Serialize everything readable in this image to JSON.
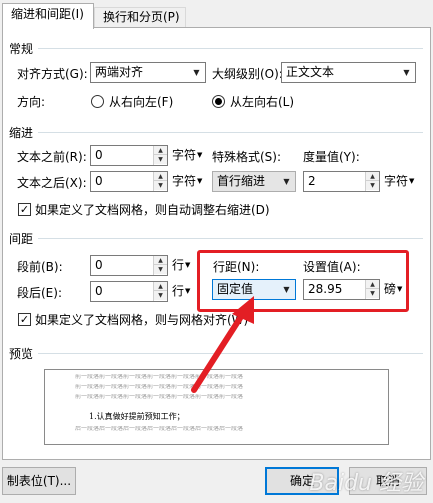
{
  "tabs": [
    {
      "label": "缩进和间距(I)",
      "active": true
    },
    {
      "label": "换行和分页(P)",
      "active": false
    }
  ],
  "general": {
    "title": "常规",
    "alignment_label": "对齐方式(G):",
    "alignment_value": "两端对齐",
    "outline_label": "大纲级别(O):",
    "outline_value": "正文文本",
    "direction_label": "方向:",
    "rtl_label": "从右向左(F)",
    "ltr_label": "从左向右(L)",
    "direction_selected": "从左向右(L)"
  },
  "indent": {
    "title": "缩进",
    "before_label": "文本之前(R):",
    "before_value": "0",
    "before_unit": "字符",
    "after_label": "文本之后(X):",
    "after_value": "0",
    "after_unit": "字符",
    "special_label": "特殊格式(S):",
    "special_value": "首行缩进",
    "measure_label": "度量值(Y):",
    "measure_value": "2",
    "measure_unit": "字符",
    "grid_check_label": "如果定义了文档网格，则自动调整右缩进(D)",
    "grid_checked": true
  },
  "spacing": {
    "title": "间距",
    "before_label": "段前(B):",
    "before_value": "0",
    "before_unit": "行",
    "after_label": "段后(E):",
    "after_value": "0",
    "after_unit": "行",
    "line_label": "行距(N):",
    "line_value": "固定值",
    "set_label": "设置值(A):",
    "set_value": "28.95",
    "set_unit": "磅",
    "grid_check_label": "如果定义了文档网格，则与网格对齐(W)",
    "grid_checked": true
  },
  "preview": {
    "title": "预览",
    "filler": "前一段落前一段落前一段落前一段落前一段落前一段落前一段落",
    "sample_text": "1.认真做好提前预知工作；",
    "after_filler": "后一段落后一段落后一段落后一段落后一段落后一段落后一段落"
  },
  "buttons": {
    "tabs": "制表位(T)...",
    "ok": "确定",
    "cancel": "取消"
  },
  "annotation": {
    "highlight_color": "#e31e24"
  },
  "watermark": "Baidu 经验",
  "colors": {
    "accent": "#0078d7",
    "annotation_red": "#e31e24"
  }
}
